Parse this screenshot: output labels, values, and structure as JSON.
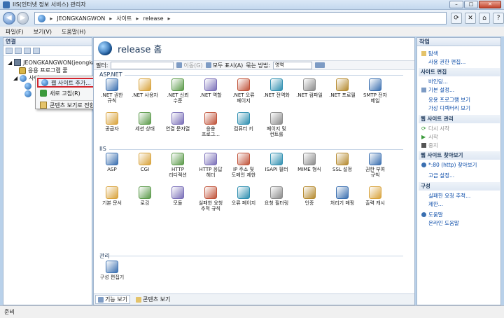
{
  "window": {
    "title": "IIS(인터넷 정보 서비스) 관리자"
  },
  "address": {
    "crumbs": [
      "JEONGKANGWON",
      "사이트",
      "release"
    ]
  },
  "menu": {
    "items": [
      "파일(F)",
      "보기(V)",
      "도움말(H)"
    ]
  },
  "left_panel": {
    "title": "연결",
    "tree": {
      "server": "JEONGKANGWON(jeongkang",
      "pools": "응용 프로그램 풀",
      "sites": "사이트"
    }
  },
  "context_menu": {
    "items": [
      "웹 사이트 추가...",
      "새로 고침(R)",
      "콘텐츠 보기로 전환"
    ]
  },
  "main": {
    "title": "release 홈",
    "filter": {
      "label": "필터:",
      "go": "이동(G)",
      "show_all": "모두 표시(A)",
      "group_by_label": "묶는 방법:",
      "group_by_value": "영역"
    },
    "groups": {
      "aspnet": "ASP.NET",
      "iis": "IIS",
      "management": "관리"
    },
    "features_aspnet": [
      [
        ".NET 권한",
        "규칙"
      ],
      [
        ".NET 사용자",
        ""
      ],
      [
        ".NET 신뢰",
        "수준"
      ],
      [
        ".NET 역할",
        ""
      ],
      [
        ".NET 오류",
        "페이지"
      ],
      [
        ".NET 전역화",
        ""
      ],
      [
        ".NET 컴파일",
        ""
      ],
      [
        ".NET 프로필",
        ""
      ],
      [
        "SMTP 전자",
        "메일"
      ],
      [
        "공급자",
        ""
      ],
      [
        "세션 상태",
        ""
      ],
      [
        "연결 문자열",
        ""
      ],
      [
        "응용",
        "프로그..."
      ],
      [
        "컴퓨터 키",
        ""
      ],
      [
        "페이지 및",
        "컨트롤"
      ]
    ],
    "features_iis": [
      [
        "ASP",
        ""
      ],
      [
        "CGI",
        ""
      ],
      [
        "HTTP",
        "리디렉션"
      ],
      [
        "HTTP 응답",
        "헤더"
      ],
      [
        "IP 주소 및",
        "도메인 제한"
      ],
      [
        "ISAPI 필터",
        ""
      ],
      [
        "MIME 형식",
        ""
      ],
      [
        "SSL 설정",
        ""
      ],
      [
        "권한 부여",
        "규칙"
      ],
      [
        "기본 문서",
        ""
      ],
      [
        "로깅",
        ""
      ],
      [
        "모듈",
        ""
      ],
      [
        "실패한 요청",
        "추적 규칙"
      ],
      [
        "오류 페이지",
        ""
      ],
      [
        "요청 필터링",
        ""
      ],
      [
        "인증",
        ""
      ],
      [
        "처리기 매핑",
        ""
      ],
      [
        "출력 캐시",
        ""
      ]
    ],
    "features_mgmt": [
      [
        "구성 편집기",
        ""
      ]
    ],
    "tabs": [
      "기능 보기",
      "콘텐츠 보기"
    ]
  },
  "actions": {
    "title": "작업",
    "items": {
      "explore": "탐색",
      "edit_perms": "사용 권한 편집...",
      "edit_site": "사이트 편집",
      "bindings": "바인딩...",
      "basic_settings": "기본 설정...",
      "view_apps": "응용 프로그램 보기",
      "view_vdirs": "가상 디렉터리 보기",
      "manage_site": "웹 사이트 관리",
      "restart": "다시 시작",
      "start": "시작",
      "stop": "중지",
      "browse_site": "웹 사이트 찾아보기",
      "browse_http": "*:80 (http) 찾아보기",
      "advanced": "고급 설정...",
      "configure": "구성",
      "failed_trace": "실패한 요청 추적...",
      "limits": "제한...",
      "help": "도움말",
      "online_help": "온라인 도움말"
    }
  },
  "status": {
    "text": "준비"
  },
  "colors": {
    "accent": "#1c5fa8",
    "highlight": "#d3262e"
  }
}
